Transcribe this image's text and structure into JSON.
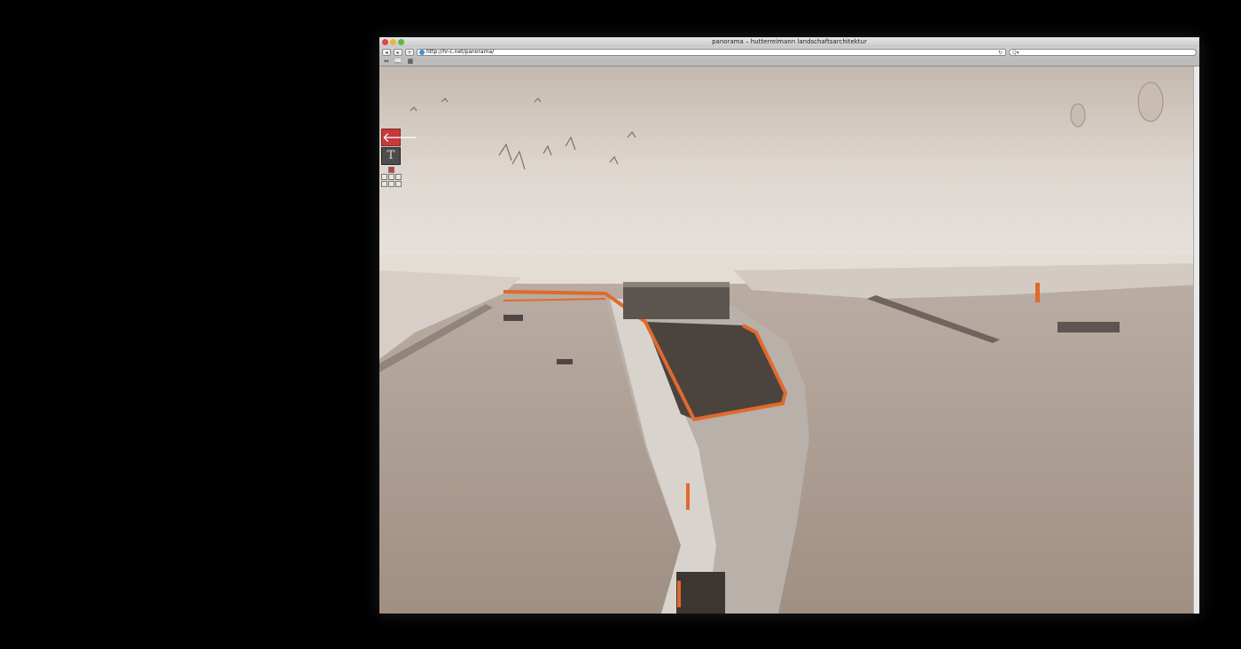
{
  "window": {
    "title": "panorama – hutterreimann landschaftsarchitektur"
  },
  "toolbar": {
    "back_glyph": "◂",
    "forward_glyph": "▸",
    "add_glyph": "+",
    "url": "http://hr-c.net/panorama/",
    "reload_glyph": "↻",
    "search_placeholder": "Q▾"
  },
  "bookmarks": {
    "items": [
      "⇔",
      "📖",
      "▦"
    ]
  },
  "panel": {
    "back_glyph": "🡐",
    "text_label": "T",
    "grid_active_index": 1
  },
  "colors": {
    "accent": "#e06a2c",
    "water": "#9f8e82",
    "sky": "#d9d0c7"
  }
}
